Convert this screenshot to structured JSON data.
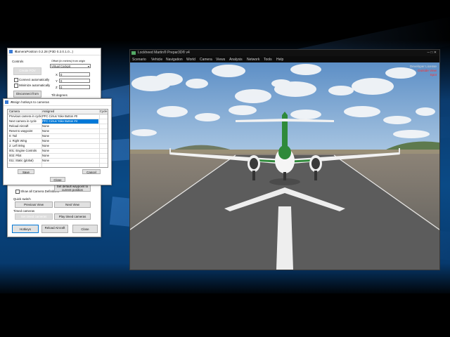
{
  "sim": {
    "title": "Lockheed Martin® Prepar3D® v4",
    "menu": [
      "Scenario",
      "Vehicle",
      "Navigation",
      "World",
      "Camera",
      "Views",
      "Analysis",
      "Network",
      "Tools",
      "Help"
    ],
    "hud": {
      "line1": "Developer License",
      "line2": "Outside View",
      "line3": "Spot",
      "line1_color": "#d8d8d8",
      "line2_color": "#ff3030",
      "line3_color": "#ff3030"
    }
  },
  "camera_window": {
    "title": "CameraPosition 0.2.28 (P3D 0.2.0.1.0...)",
    "controls_label": "Controls",
    "offset_label": "Offset (in meters) from origin",
    "virtual_cockpit": "Virtual Cockpit",
    "x_label": "X",
    "x_value": "0",
    "y_label": "Y",
    "y_value": "0",
    "z_label": "Z",
    "z_value": "0",
    "create_fov_button": "Create FOV",
    "connect_auto": "Connect automatically",
    "minimize_auto": "Minimize automatically",
    "disconnect_button": "Disconnect from P3D",
    "tilt_label": "Tilt degrees",
    "show_all": "Show all Camera Definitions",
    "set_default_button": "Set default waypoint to current position",
    "quick_switch": "Quick switch",
    "previous_view": "Previous View",
    "next_view": "Next View",
    "timed_cameras": "Timed cameras",
    "set_timed_button": "Set timed cameras",
    "play_timed_button": "Play timed cameras",
    "hotkeys_button": "Hotkeys",
    "reload_aircraft_button": "Reload Aircraft",
    "close_button": "Close"
  },
  "hotkeys_dialog": {
    "title": "Assign hotkeys to cameras",
    "headers": [
      "Camera",
      "Assigned",
      "Cycle"
    ],
    "rows": [
      {
        "camera": "Previous camera in cycle",
        "assigned": "PFC Cirrus Yoke Button #0"
      },
      {
        "camera": "Next camera in cycle",
        "assigned": "PFC Cirrus Yoke Button #4"
      },
      {
        "camera": "Reload Aircraft",
        "assigned": "None"
      },
      {
        "camera": "Reset to waypoint",
        "assigned": "None"
      },
      {
        "camera": "0: Tail",
        "assigned": "None"
      },
      {
        "camera": "1: Right Wing",
        "assigned": "None"
      },
      {
        "camera": "2: Left Wing",
        "assigned": "None"
      },
      {
        "camera": "001: Engine Controls",
        "assigned": "None"
      },
      {
        "camera": "003: Pilot",
        "assigned": "None"
      },
      {
        "camera": "011: Static (global)",
        "assigned": "None"
      }
    ],
    "save_button": "Save",
    "cancel_button": "Cancel",
    "close_button": "Close"
  },
  "colors": {
    "selection": "#0078d7",
    "sky_top": "#5d8fc6",
    "runway": "#5c5c5c",
    "aircraft_stripe": "#2f8a3a"
  }
}
